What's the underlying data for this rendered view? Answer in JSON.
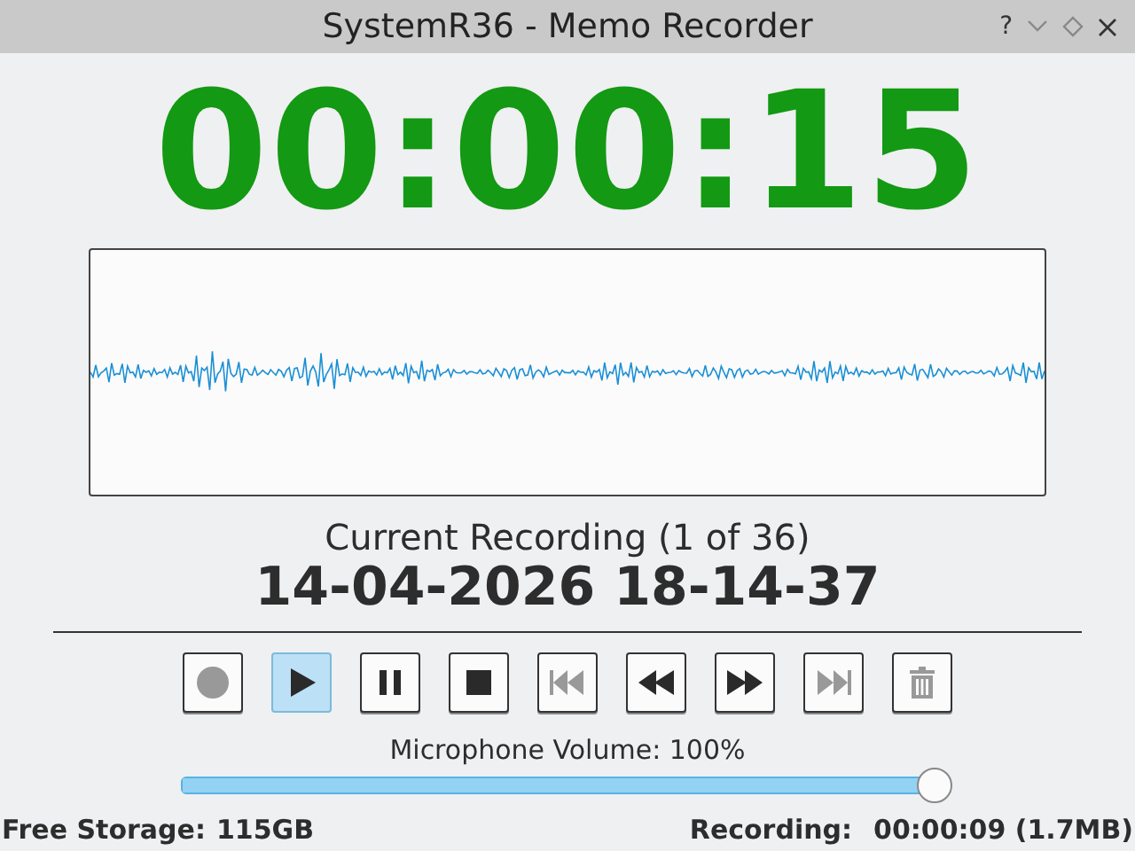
{
  "window": {
    "title": "SystemR36 - Memo Recorder",
    "controls": [
      "?"
    ]
  },
  "timer": "00:00:15",
  "recording": {
    "label": "Current Recording (1 of 36)",
    "name": "14-04-2026 18-14-37"
  },
  "buttons": [
    {
      "kind": "record",
      "disabled": true,
      "selected": false
    },
    {
      "kind": "play",
      "disabled": false,
      "selected": true
    },
    {
      "kind": "pause",
      "disabled": false,
      "selected": false
    },
    {
      "kind": "stop",
      "disabled": false,
      "selected": false
    },
    {
      "kind": "skip-back",
      "disabled": true,
      "selected": false
    },
    {
      "kind": "rewind",
      "disabled": false,
      "selected": false
    },
    {
      "kind": "forward",
      "disabled": false,
      "selected": false
    },
    {
      "kind": "skip-forward",
      "disabled": true,
      "selected": false
    },
    {
      "kind": "delete",
      "disabled": true,
      "selected": false
    }
  ],
  "volume": {
    "label": "Microphone Volume: 100%",
    "level": 1.0
  },
  "status_bar": {
    "storage_label": "Free Storage:",
    "storage_value": "115GB",
    "recording_label": "Recording:",
    "recording_value": "00:00:09 (1.7MB)"
  }
}
